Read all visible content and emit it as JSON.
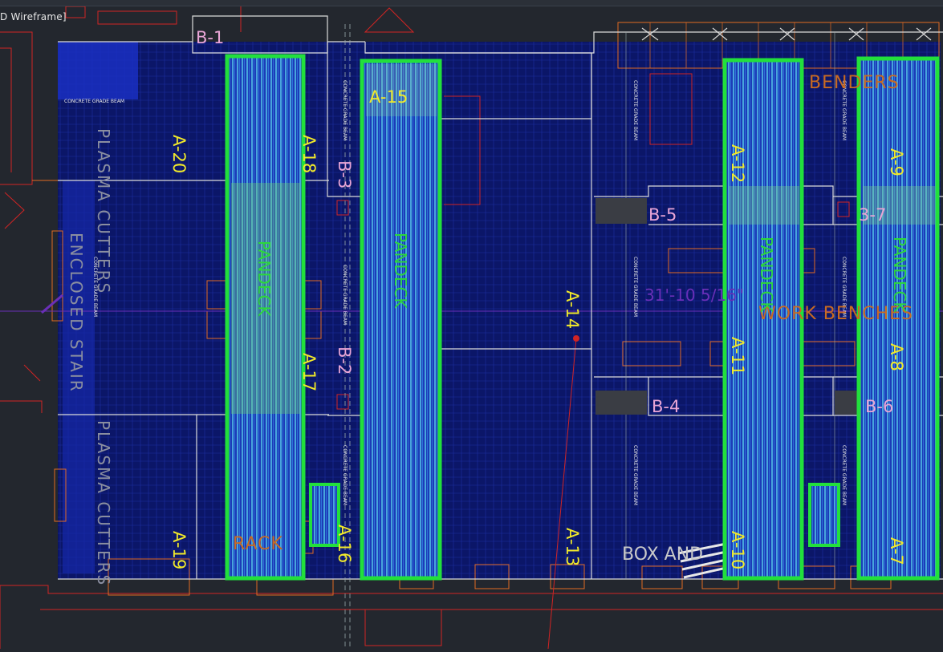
{
  "viewport_label": "D Wireframe]",
  "colors": {
    "canvas": "#23272e",
    "scan": "#0a1466",
    "scan_bright": "#2448c8",
    "highlight": "#22e03c",
    "bay_label": "#f2ea2a",
    "beam_label": "#e9a5d6",
    "cad_red": "#d12424",
    "cad_orange": "#e26b22",
    "dimension": "#6a2fb8"
  },
  "bays": [
    {
      "id": "A-20",
      "label": "A-20"
    },
    {
      "id": "A-19",
      "label": "A-19"
    },
    {
      "id": "A-18",
      "label": "A-18"
    },
    {
      "id": "A-17",
      "label": "A-17"
    },
    {
      "id": "A-16",
      "label": "A-16"
    },
    {
      "id": "A-15",
      "label": "A-15"
    },
    {
      "id": "A-14",
      "label": "A-14"
    },
    {
      "id": "A-13",
      "label": "A-13"
    },
    {
      "id": "A-12",
      "label": "A-12"
    },
    {
      "id": "A-11",
      "label": "A-11"
    },
    {
      "id": "A-10",
      "label": "A-10"
    },
    {
      "id": "A-9",
      "label": "A-9"
    },
    {
      "id": "A-8",
      "label": "A-8"
    },
    {
      "id": "A-7",
      "label": "A-7"
    }
  ],
  "beams": [
    {
      "id": "B-1",
      "label": "B-1"
    },
    {
      "id": "B-2",
      "label": "B-2"
    },
    {
      "id": "B-3",
      "label": "B-3"
    },
    {
      "id": "B-4",
      "label": "B-4"
    },
    {
      "id": "B-5",
      "label": "B-5"
    },
    {
      "id": "B-6",
      "label": "B-6"
    },
    {
      "id": "B-7",
      "label": "3-7"
    }
  ],
  "cad_text": {
    "concrete_grade_beam": "CONCRETE GRADE BEAM",
    "plasma_cutters_top": "PLASMA CUTTERS",
    "plasma_cutters_bottom": "PLASMA CUTTERS",
    "enclosed_stair": "ENCLOSED STAIR",
    "benders": "BENDERS",
    "work_benches": "WORK BENCHES",
    "box_and": "BOX AND",
    "rack": "RACK",
    "dimension": "31'-10 5/16\""
  },
  "highlight_text": [
    "PANDECK",
    "PANDECK",
    "PANDECK",
    "PANDECK"
  ]
}
